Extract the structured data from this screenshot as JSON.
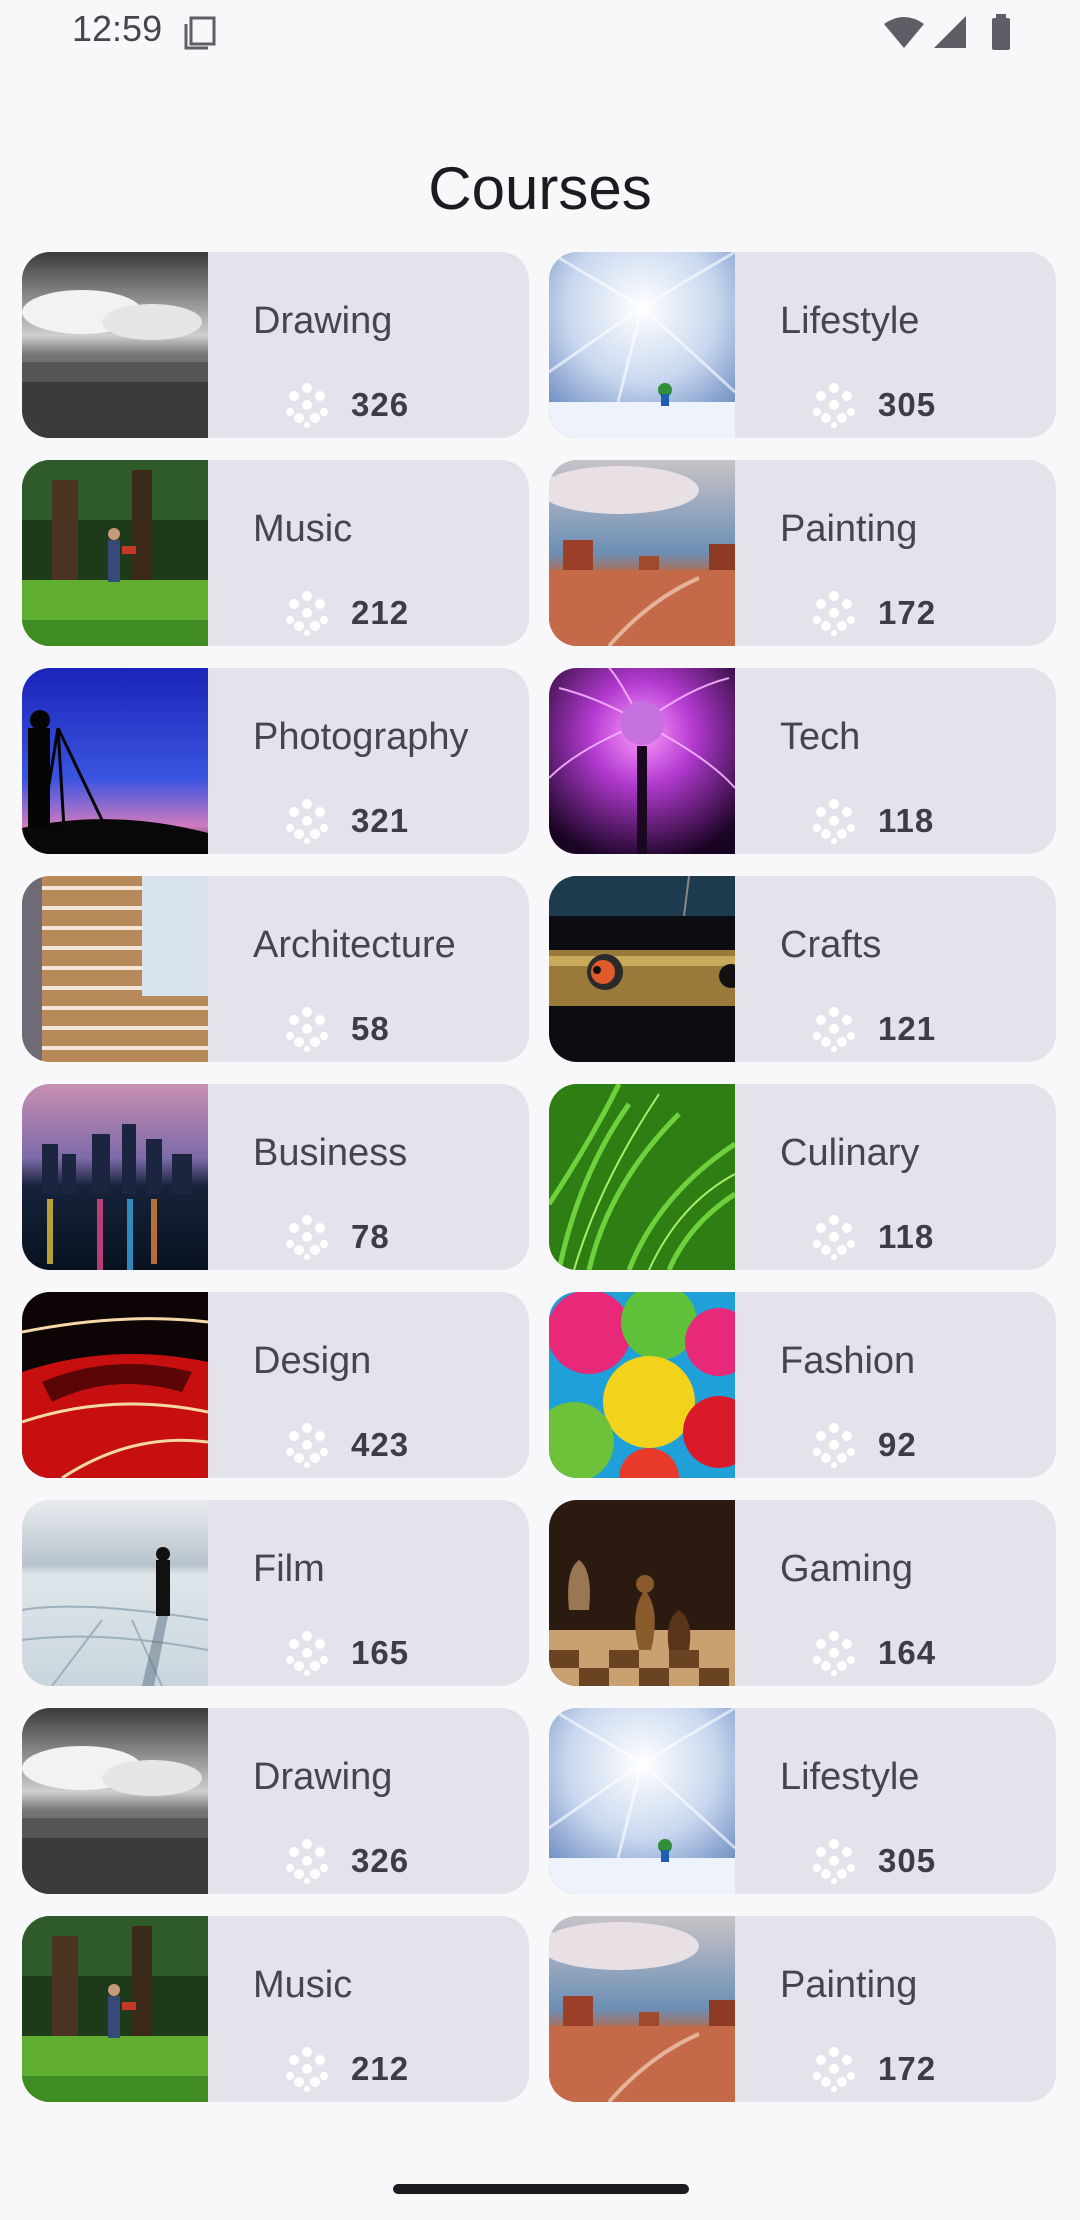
{
  "status": {
    "time": "12:59"
  },
  "title": "Courses",
  "courses": [
    {
      "label": "Drawing",
      "count": "326",
      "image": "clouds-landscape-bw"
    },
    {
      "label": "Lifestyle",
      "count": "305",
      "image": "skier-light-burst"
    },
    {
      "label": "Music",
      "count": "212",
      "image": "person-under-trees"
    },
    {
      "label": "Painting",
      "count": "172",
      "image": "desert-mesas"
    },
    {
      "label": "Photography",
      "count": "321",
      "image": "photographer-silhouette"
    },
    {
      "label": "Tech",
      "count": "118",
      "image": "plasma-ball"
    },
    {
      "label": "Architecture",
      "count": "58",
      "image": "building-facade"
    },
    {
      "label": "Crafts",
      "count": "121",
      "image": "bird-in-pipe"
    },
    {
      "label": "Business",
      "count": "78",
      "image": "city-skyline-night"
    },
    {
      "label": "Culinary",
      "count": "118",
      "image": "green-grass"
    },
    {
      "label": "Design",
      "count": "423",
      "image": "red-car-light-trails"
    },
    {
      "label": "Fashion",
      "count": "92",
      "image": "colorful-umbrellas"
    },
    {
      "label": "Film",
      "count": "165",
      "image": "person-on-salt-flats"
    },
    {
      "label": "Gaming",
      "count": "164",
      "image": "chess-pieces"
    },
    {
      "label": "Drawing",
      "count": "326",
      "image": "clouds-landscape-bw"
    },
    {
      "label": "Lifestyle",
      "count": "305",
      "image": "skier-light-burst"
    },
    {
      "label": "Music",
      "count": "212",
      "image": "person-under-trees"
    },
    {
      "label": "Painting",
      "count": "172",
      "image": "desert-mesas"
    }
  ]
}
